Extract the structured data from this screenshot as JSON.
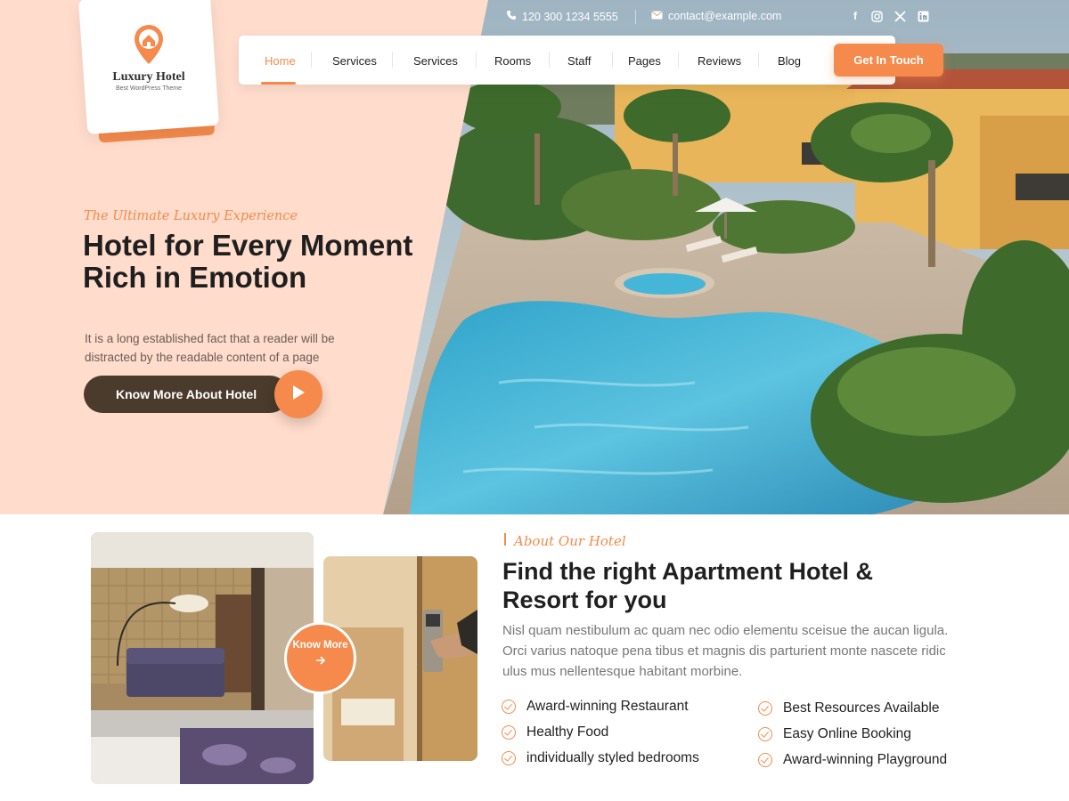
{
  "brand": {
    "name": "Luxury Hotel",
    "tagline": "Best WordPress Theme"
  },
  "topbar": {
    "phone": "120 300 1234 5555",
    "email": "contact@example.com",
    "social": [
      "facebook-icon",
      "instagram-icon",
      "x-icon",
      "linkedin-icon"
    ]
  },
  "nav": {
    "items": [
      "Home",
      "Services",
      "Services",
      "Rooms",
      "Staff",
      "Pages",
      "Reviews",
      "Blog"
    ],
    "active": "Home",
    "cta": "Get In Touch"
  },
  "hero": {
    "eyebrow": "The Ultimate Luxury Experience",
    "title": "Hotel for Every Moment Rich in Emotion",
    "description": "It is a long established fact that a reader will be distracted by the readable content of a page",
    "button": "Know More About Hotel"
  },
  "about": {
    "eyebrow": "About Our Hotel",
    "title": "Find the right Apartment Hotel & Resort for you",
    "description": "Nisl quam nestibulum ac quam nec odio elementu sceisue the aucan ligula. Orci varius natoque pena tibus et magnis dis parturient monte nascete ridic ulus mus nellentesque habitant morbine.",
    "know_more": "Know More",
    "features_left": [
      "Award-winning Restaurant",
      "Healthy Food",
      "individually styled bedrooms"
    ],
    "features_right": [
      "Best Resources Available",
      "Easy Online Booking",
      "Award-winning Playground"
    ]
  },
  "colors": {
    "accent": "#f58a4c",
    "hero_bg": "#ffdccb",
    "dark_button": "#4a3b2c"
  }
}
